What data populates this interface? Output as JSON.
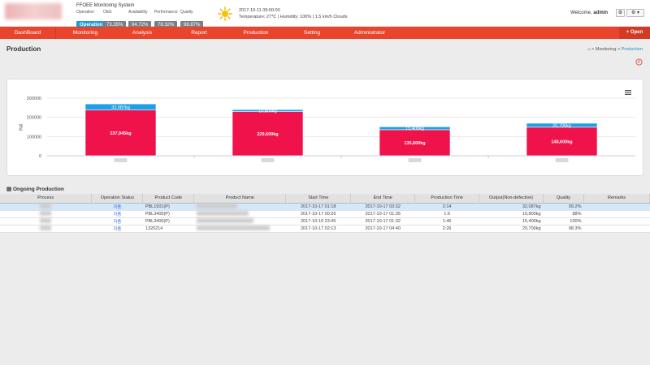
{
  "header": {
    "system_title": "FFOEE Monitoring System",
    "kpis": [
      {
        "label": "Operation",
        "value": "Operation"
      },
      {
        "label": "OEE",
        "value": "73.35%"
      },
      {
        "label": "Availability",
        "value": "94.72%"
      },
      {
        "label": "Performance",
        "value": "78.32%"
      },
      {
        "label": "Quality",
        "value": "98.87%"
      }
    ],
    "weather_datetime": "2017-10-11 09:00:00",
    "weather_detail": "Temperature: 27℃ | Humidity: 100% | 1.5 km/h Clouds",
    "welcome_prefix": "Welcome,",
    "welcome_user": "admin",
    "settings_btn": "⚙",
    "gear_btn": "⚙ ▾"
  },
  "nav": {
    "items": [
      "DashBoard",
      "Monitoring",
      "Analysis",
      "Report",
      "Production",
      "Setting",
      "Administrator"
    ],
    "open_label": "+ Open",
    "accent": "#e9452d"
  },
  "page": {
    "title": "Production",
    "breadcrumb": [
      "Monitoring",
      "Production"
    ]
  },
  "chart_data": {
    "type": "bar",
    "stacked": true,
    "ylabel": "(kg)",
    "yticks": [
      "0",
      "100000",
      "200000",
      "300000"
    ],
    "ylim": [
      0,
      300000
    ],
    "categories": [
      "",
      "",
      "",
      ""
    ],
    "series": [
      {
        "values": [
          237945,
          229600,
          135600,
          148600
        ],
        "labels": [
          "237,945kg",
          "229,600kg",
          "135,600kg",
          "148,600kg"
        ],
        "color": "#f0124a"
      },
      {
        "values": [
          32087,
          10800,
          15400,
          20700
        ],
        "labels": [
          "32,087kg",
          "10,800kg",
          "15,400kg",
          "20,700kg"
        ],
        "color": "#1fa0e6"
      }
    ]
  },
  "ongoing": {
    "title": "Ongoing Production",
    "columns": [
      "Process",
      "Operation Status",
      "Product Code",
      "Product Name",
      "Start Time",
      "End Time",
      "Production Time",
      "Output(Non-defective)",
      "Quality",
      "Remarks"
    ],
    "rows": [
      {
        "status": "가동",
        "code": "PBL1501(P)",
        "start": "2017-10-17 01:18",
        "end": "2017-10-17 03:32",
        "ptime": "2:14",
        "output": "32,087kg",
        "quality": "99.2%"
      },
      {
        "status": "가동",
        "code": "PBL3405(P)",
        "start": "2017-10-17 00:26",
        "end": "2017-10-17 01:35",
        "ptime": "1:9",
        "output": "10,800kg",
        "quality": "88%"
      },
      {
        "status": "가동",
        "code": "PBL3406(P)",
        "start": "2017-10-16 23:45",
        "end": "2017-10-17 01:32",
        "ptime": "1:46",
        "output": "15,400kg",
        "quality": "100%"
      },
      {
        "status": "가동",
        "code": "1320214",
        "start": "2017-10-17 02:13",
        "end": "2017-10-17 04:40",
        "ptime": "2:26",
        "output": "20,700kg",
        "quality": "98.3%"
      }
    ]
  }
}
